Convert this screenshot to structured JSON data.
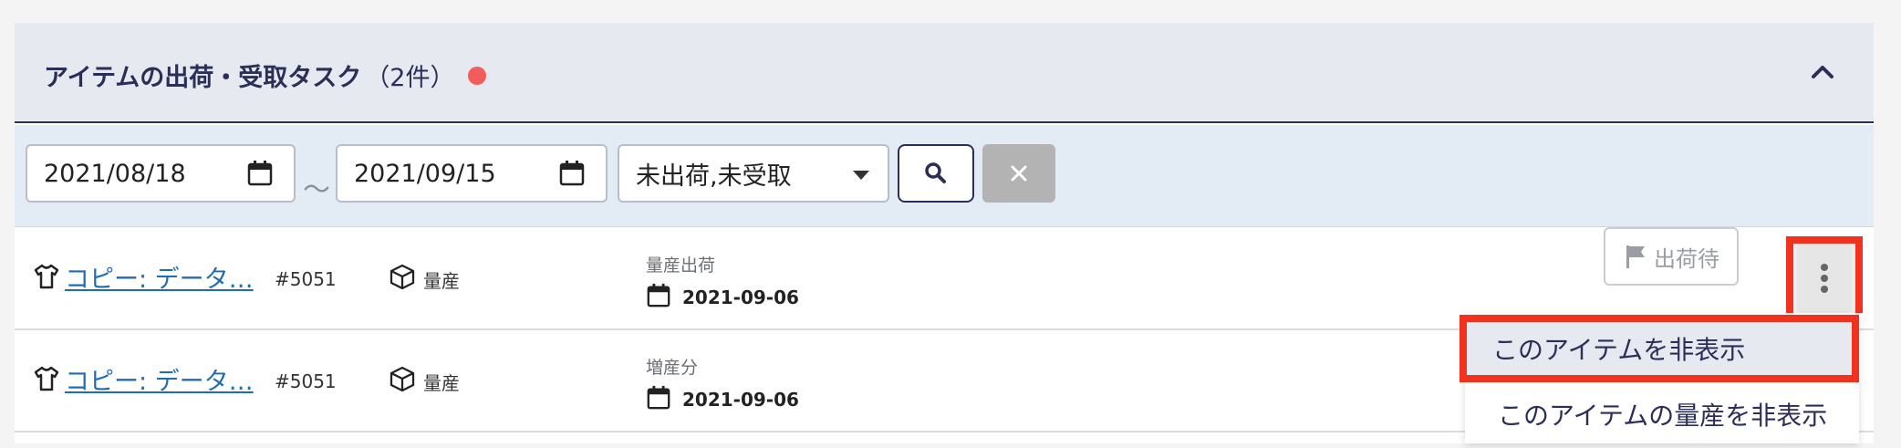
{
  "panel": {
    "title": "アイテムの出荷・受取タスク",
    "count": "（2件）",
    "dot_color": "#f25c5c"
  },
  "filters": {
    "date_from": "2021/08/18",
    "tilde": "〜",
    "date_to": "2021/09/15",
    "status_select": "未出荷,未受取"
  },
  "rows": [
    {
      "name": "コピー: データ…",
      "number": "#5051",
      "kind": "量産",
      "sub_label": "量産出荷",
      "date": "2021-09-06",
      "status": "出荷待"
    },
    {
      "name": "コピー: データ…",
      "number": "#5051",
      "kind": "量産",
      "sub_label": "増産分",
      "date": "2021-09-06"
    }
  ],
  "menu": {
    "items": [
      "このアイテムを非表示",
      "このアイテムの量産を非表示"
    ]
  }
}
